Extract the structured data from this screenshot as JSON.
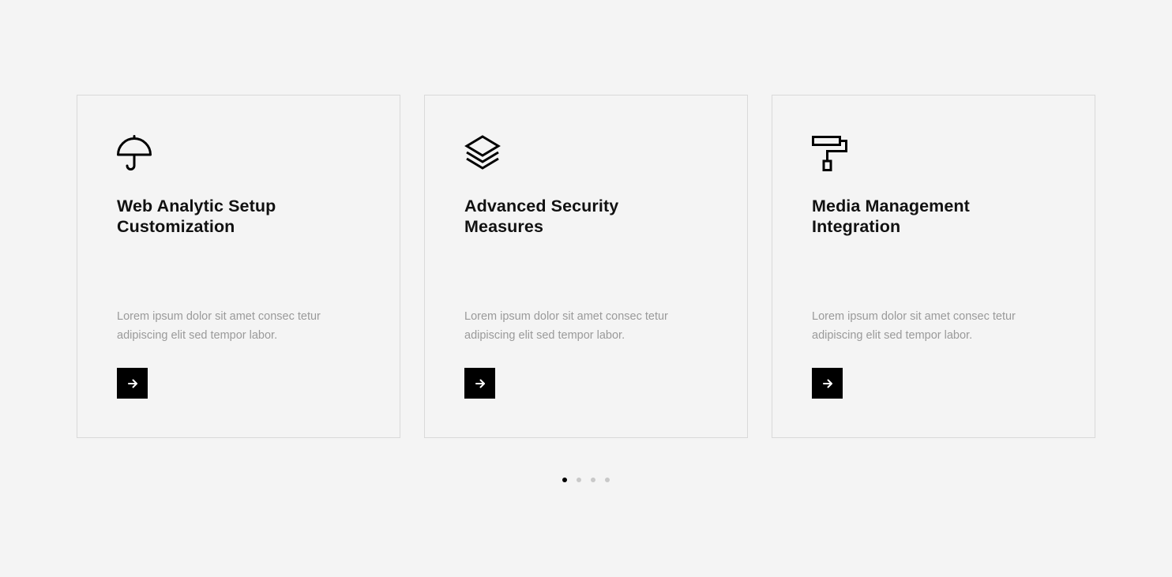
{
  "cards": [
    {
      "icon": "umbrella-icon",
      "title_line1": "Web Analytic Setup",
      "title_line2": "Customization",
      "description_line1": "Lorem ipsum dolor sit amet consec tetur",
      "description_line2": "adipiscing elit sed tempor labor.",
      "button_icon": "arrow-right-icon"
    },
    {
      "icon": "layers-icon",
      "title_line1": "Advanced Security",
      "title_line2": "Measures",
      "description_line1": "Lorem ipsum dolor sit amet consec tetur",
      "description_line2": "adipiscing elit sed tempor labor.",
      "button_icon": "arrow-right-icon"
    },
    {
      "icon": "paint-roller-icon",
      "title_line1": "Media Management",
      "title_line2": "Integration",
      "description_line1": "Lorem ipsum dolor sit amet consec tetur",
      "description_line2": "adipiscing elit sed tempor labor.",
      "button_icon": "arrow-right-icon"
    }
  ],
  "pagination": {
    "total": 4,
    "active_index": 0
  },
  "colors": {
    "background": "#f4f4f4",
    "card_border": "#d9d9d9",
    "title": "#111111",
    "description": "#9a9a9a",
    "button": "#000000",
    "dot_active": "#000000",
    "dot_inactive": "#c9c9c9"
  }
}
